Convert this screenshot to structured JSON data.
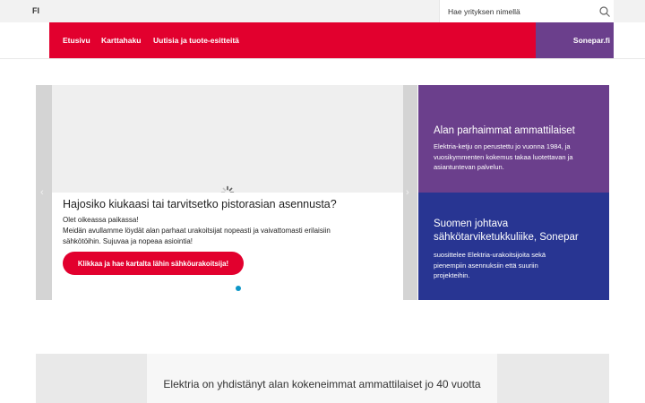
{
  "header": {
    "language": "FI",
    "search_placeholder": "Hae yrityksen nimellä"
  },
  "nav": {
    "items": [
      "Etusivu",
      "Karttahaku",
      "Uutisia ja tuote-esitteitä"
    ],
    "sonepar": "Sonepar.fi"
  },
  "hero": {
    "title": "Hajosiko kiukaasi tai tarvitsetko pistorasian asennusta?",
    "line1": "Olet oikeassa paikassa!",
    "line2": "Meidän avullamme löydät alan parhaat urakoitsijat nopeasti ja vaivattomasti erilaisiin sähkötöihin. Sujuvaa ja nopeaa asiointia!",
    "cta": "Klikkaa ja hae kartalta lähin sähköurakoitsija!",
    "arrow_prev": "‹",
    "arrow_next": "›"
  },
  "panels": [
    {
      "title": "Alan parhaimmat ammattilaiset",
      "text": "Elektria-ketju on perustettu jo vuonna 1984, ja vuosikymmenten kokemus takaa luotettavan ja asiantuntevan palvelun."
    },
    {
      "title": "Suomen johtava sähkötarviketukkuliike, Sonepar",
      "text": "suosittelee Elektria-urakoitsijoita sekä pienempiin asennuksiin että suuriin projekteihin."
    }
  ],
  "bottom": {
    "text": "Elektria on yhdistänyt alan kokeneimmat ammattilaiset jo 40 vuotta"
  },
  "colors": {
    "brand_red": "#e2002e",
    "sonepar_purple": "#6b3f8c",
    "panel_blue": "#283592",
    "dot_active": "#0d96c7"
  },
  "icons": {
    "search": "search-icon",
    "loading": "loading-spinner-icon"
  }
}
